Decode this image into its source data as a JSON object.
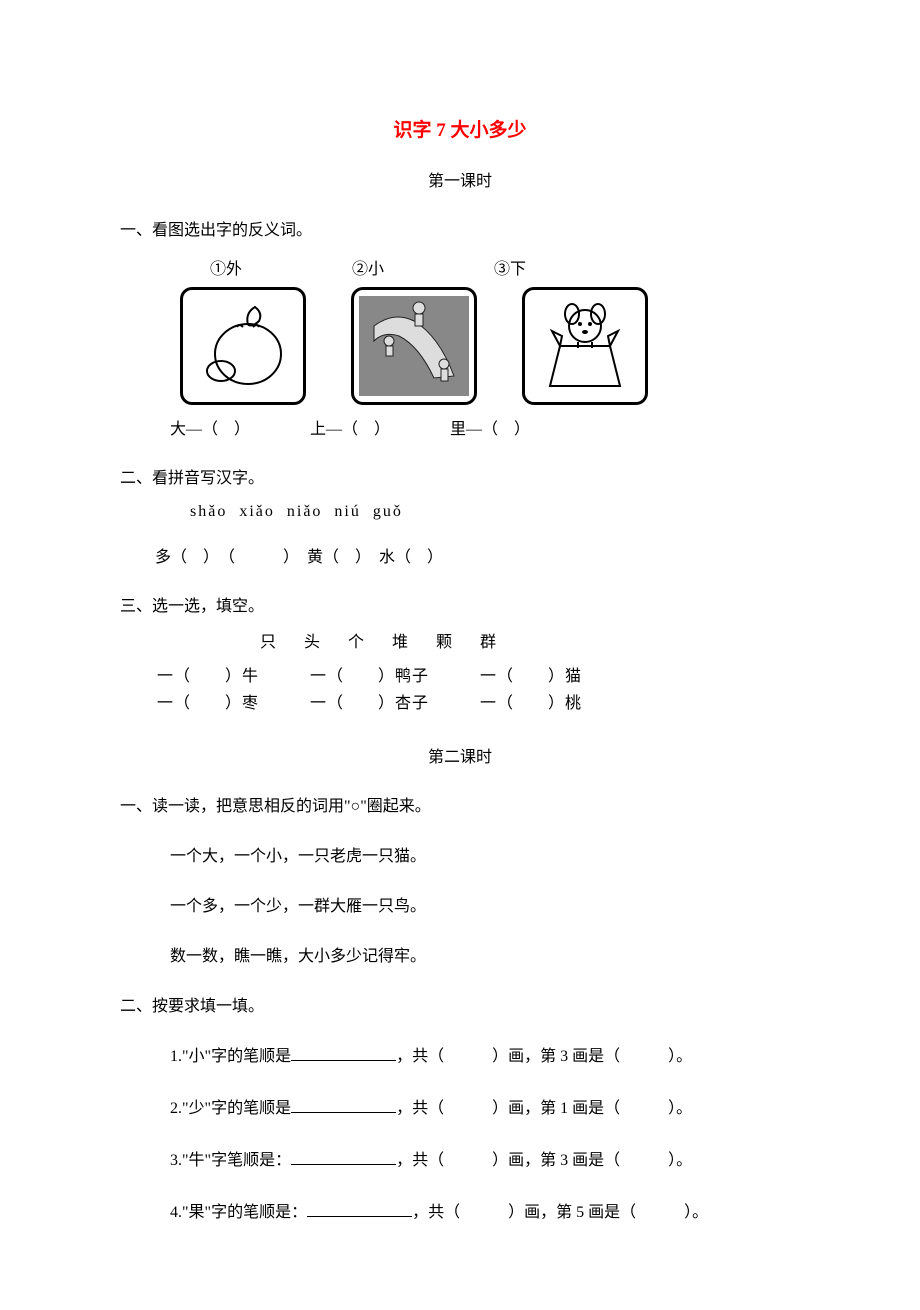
{
  "title": "识字 7 大小多少",
  "lesson1_label": "第一课时",
  "s1": {
    "head": "一、看图选出字的反义词。",
    "labels": [
      "①外",
      "②小",
      "③下"
    ],
    "images_alt": [
      "eggplant-image",
      "slide-playground-image",
      "dog-in-box-image"
    ],
    "under": [
      "大—（　）",
      "上—（　）",
      "里—（　）"
    ]
  },
  "s2": {
    "head": "二、看拼音写汉字。",
    "pinyin": "shǎo  xiǎo niǎo     niú     guǒ",
    "line": "多（　）　（　　　）　黄（　）　水（　）"
  },
  "s3": {
    "head": "三、选一选，填空。",
    "choices": "只 头 个 堆 颗 群",
    "row1": "　一（　　）牛　　　一（　　）鸭子　　　一（　　）猫",
    "row2": "　一（　　）枣　　　一（　　）杏子　　　一（　　）桃"
  },
  "lesson2_label": "第二课时",
  "p2s1": {
    "head": "一、读一读，把意思相反的词用\"○\"圈起来。",
    "l1": "一个大，一个小，一只老虎一只猫。",
    "l2": "一个多，一个少，一群大雁一只鸟。",
    "l3": "数一数，瞧一瞧，大小多少记得牢。"
  },
  "p2s2": {
    "head": "二、按要求填一填。",
    "q1a": "1.\"小\"字的笔顺是",
    "q1b": "，共（　　　）画，第 3 画是（　　　）。",
    "q2a": "2.\"少\"字的笔顺是",
    "q2b": "，共（　　　）画，第 1 画是（　　　）。",
    "q3a": "3.\"牛\"字笔顺是：",
    "q3b": "，共（　　　）画，第 3 画是（　　　）。",
    "q4a": "4.\"果\"字的笔顺是：",
    "q4b": "，共（　　　）画，第 5 画是（　　　）。"
  }
}
